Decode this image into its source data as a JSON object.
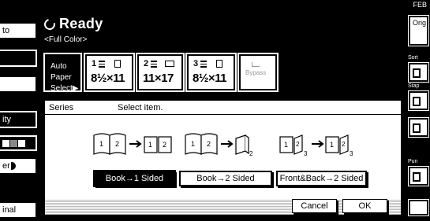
{
  "topbar": {
    "corner_text": "FEB"
  },
  "left": {
    "items": [
      {
        "label": "to",
        "dark": false
      },
      {
        "label": "",
        "dark": true
      },
      {
        "label": "",
        "dark": false
      },
      {
        "label": "ity",
        "dark": true
      },
      {
        "label": "",
        "dark": true
      },
      {
        "label": "er",
        "dark": false
      },
      {
        "label": "inal",
        "dark": false
      }
    ]
  },
  "header": {
    "status": "Ready",
    "mode": "<Full Color>"
  },
  "paper": {
    "auto_label_line1": "Auto Paper",
    "auto_label_line2": "Select▶",
    "trays": [
      {
        "tray": "1",
        "size": "8½×11"
      },
      {
        "tray": "2",
        "size": "11×17"
      },
      {
        "tray": "3",
        "size": "8½×11"
      }
    ],
    "bypass": "Bypass"
  },
  "dialog": {
    "title": "Series",
    "subtitle": "Select item.",
    "options": [
      "Book→1 Sided",
      "Book→2 Sided",
      "Front&Back→2 Sided"
    ],
    "selected_index": 0,
    "cancel": "Cancel",
    "ok": "OK"
  },
  "right": {
    "top_label": "Orig",
    "sort_label": "Sort",
    "staple_label": "Stap",
    "punch_label": "Pun"
  }
}
